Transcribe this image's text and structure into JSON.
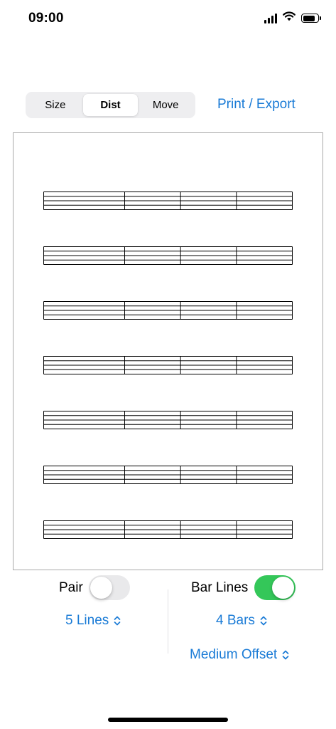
{
  "status_bar": {
    "time": "09:00",
    "icons": [
      "cellular-signal-icon",
      "wifi-icon",
      "battery-icon"
    ],
    "battery_level": 0.85
  },
  "toolbar": {
    "segments": [
      {
        "label": "Size",
        "selected": false
      },
      {
        "label": "Dist",
        "selected": true
      },
      {
        "label": "Move",
        "selected": false
      }
    ],
    "print_label": "Print / Export"
  },
  "preview": {
    "staff_count": 7,
    "lines_per_staff": 5,
    "bars_per_staff": 4,
    "offset": "medium"
  },
  "controls": {
    "pair": {
      "label": "Pair",
      "on": false
    },
    "bar_lines": {
      "label": "Bar Lines",
      "on": true
    },
    "lines_picker": {
      "label": "5 Lines"
    },
    "bars_picker": {
      "label": "4 Bars"
    },
    "offset_picker": {
      "label": "Medium Offset"
    }
  },
  "colors": {
    "accent": "#1a7bd6",
    "toggle_on": "#34c759",
    "toggle_off": "#e9e9eb",
    "segment_bg": "#eeeef0",
    "preview_border": "#a9a9a9"
  }
}
